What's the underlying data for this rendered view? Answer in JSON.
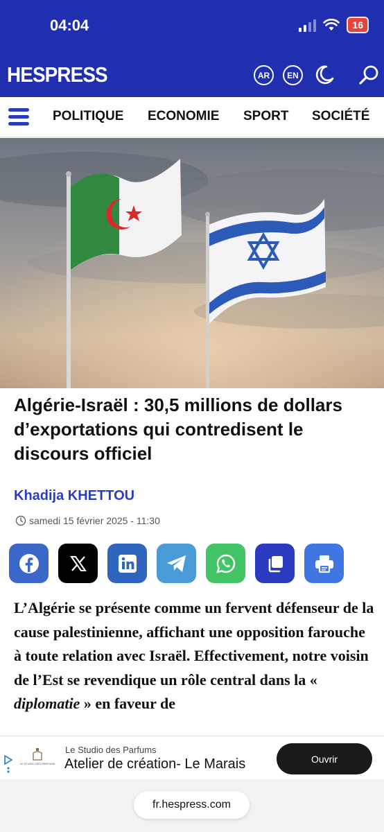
{
  "status_bar": {
    "time": "04:04",
    "battery": "16"
  },
  "header": {
    "logo": "HESPRESS",
    "lang_ar": "AR",
    "lang_en": "EN",
    "icons": [
      "moon-icon",
      "search-icon"
    ]
  },
  "nav": {
    "items": [
      "POLITIQUE",
      "ECONOMIE",
      "SPORT",
      "SOCIÉTÉ"
    ]
  },
  "article": {
    "title": "Algérie-Israël : 30,5 millions de dollars d’exportations qui contredisent le discours officiel",
    "author": "Khadija KHETTOU",
    "date": "samedi 15 février 2025 - 11:30",
    "share": [
      {
        "name": "facebook",
        "color": "#3b67c8"
      },
      {
        "name": "x",
        "color": "#000000"
      },
      {
        "name": "linkedin",
        "color": "#2f64bf"
      },
      {
        "name": "telegram",
        "color": "#4a9cd6"
      },
      {
        "name": "whatsapp",
        "color": "#43c466"
      },
      {
        "name": "copy",
        "color": "#2b3bbf"
      },
      {
        "name": "print",
        "color": "#3f76e2"
      }
    ],
    "body_1": "L’Algérie se présente comme un fervent défenseur de la cause palestinienne, affichant une opposition farouche à toute relation avec Israël. Effectivement, notre voisin de l’Est se revendique un rôle central dans la « ",
    "body_em": "diplomatie",
    "body_2": " » en faveur de"
  },
  "ad": {
    "logo_text": "LE STUDIO DES PARFUMS",
    "sponsor": "Le Studio des Parfums",
    "title": "Atelier de création- Le Marais",
    "button": "Ouvrir"
  },
  "browser": {
    "url": "fr.hespress.com"
  },
  "colors": {
    "brand_blue": "#1f2fb0",
    "nav_blue": "#2a3dbf"
  }
}
